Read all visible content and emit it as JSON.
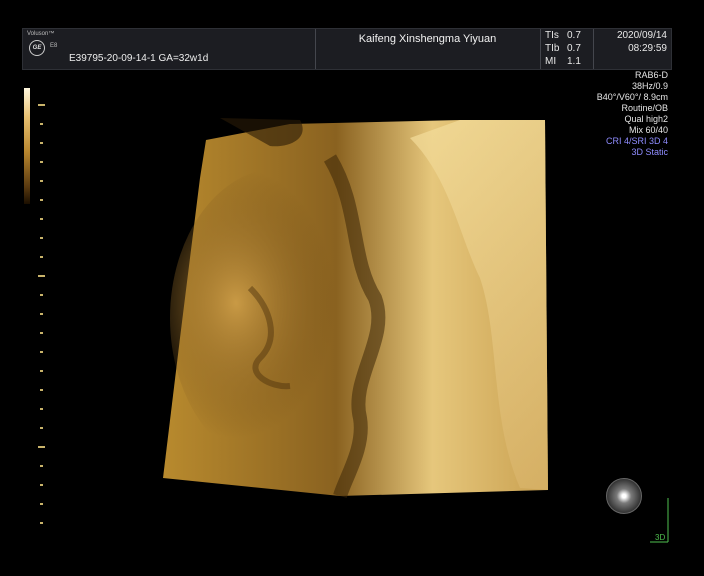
{
  "header": {
    "brand": "Voluson™",
    "brand_model": "E8",
    "logo": "GE",
    "patient_line": "E39795-20-09-14-1  GA=32w1d",
    "hospital": "Kaifeng Xinshengma Yiyuan",
    "params": [
      {
        "label": "TIs",
        "value": "0.7"
      },
      {
        "label": "TIb",
        "value": "0.7"
      },
      {
        "label": "MI",
        "value": "1.1"
      }
    ],
    "date": "2020/09/14",
    "time": "08:29:59"
  },
  "settings": [
    {
      "text": "RAB6-D",
      "color": "#e6e6e6"
    },
    {
      "text": "38Hz/0.9",
      "color": "#e6e6e6"
    },
    {
      "text": "B40°/V60°/ 8.9cm",
      "color": "#e6e6e6"
    },
    {
      "text": "Routine/OB",
      "color": "#e6e6e6"
    },
    {
      "text": "Qual high2",
      "color": "#e6e6e6"
    },
    {
      "text": "Mix 60/40",
      "color": "#e6e6e6"
    },
    {
      "text": "CRI 4/SRI 3D 4",
      "color": "#8f8cff"
    },
    {
      "text": "3D Static",
      "color": "#8f8cff"
    }
  ],
  "render_colors": {
    "tint_light": "#f3dc9a",
    "tint_mid": "#b88a2e",
    "tint_dark": "#3d2608"
  },
  "label_3d": "3D",
  "icons": [
    "ge-logo-icon",
    "orientation-ball-icon",
    "3d-axis-icon"
  ]
}
